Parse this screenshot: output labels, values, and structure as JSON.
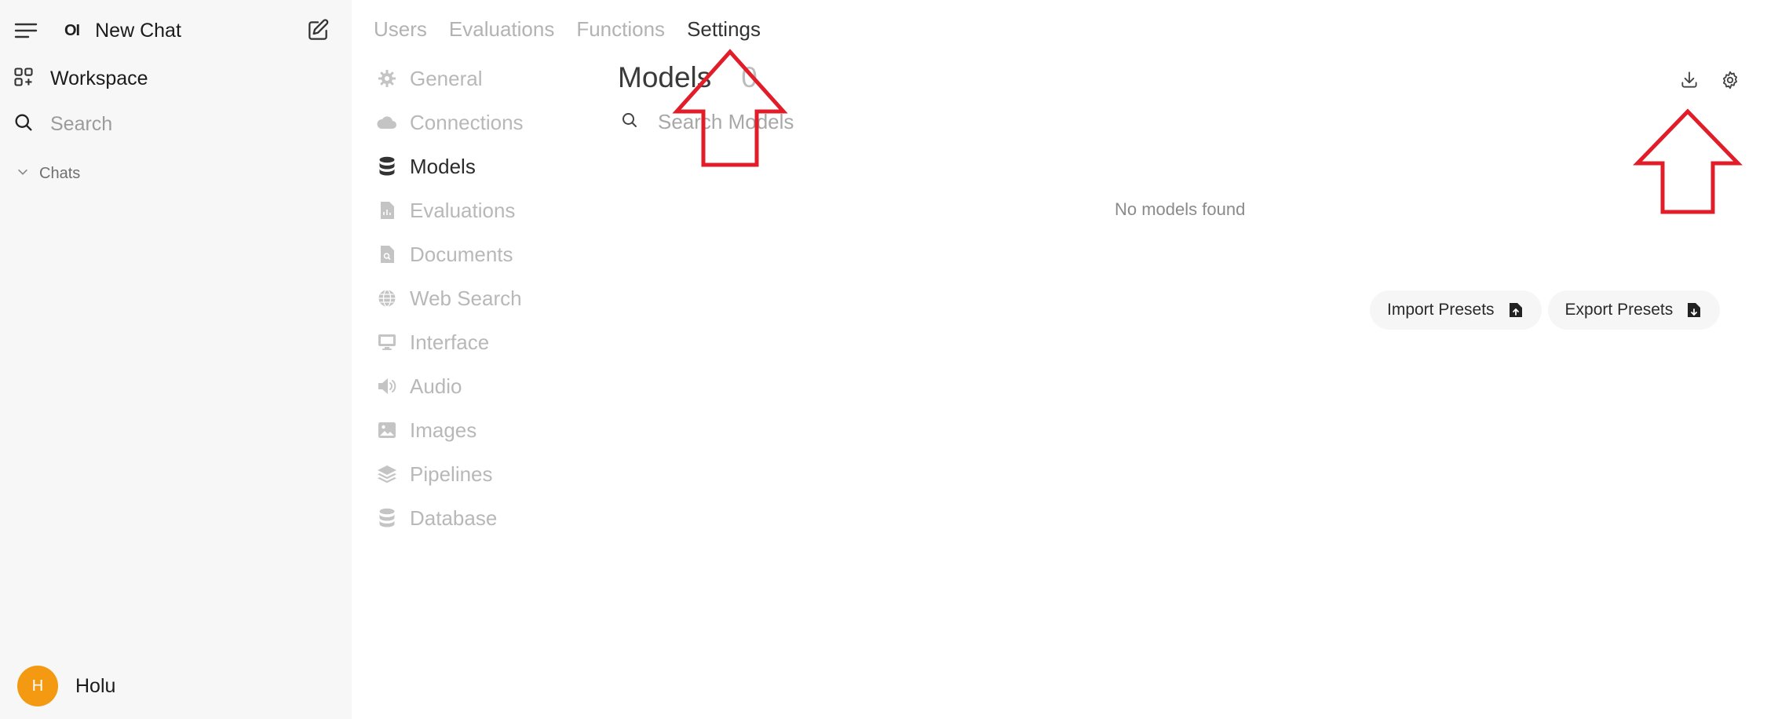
{
  "sidebar": {
    "new_chat": "New Chat",
    "logo": "OI",
    "workspace": "Workspace",
    "search_placeholder": "Search",
    "chats": "Chats",
    "user": {
      "initial": "H",
      "name": "Holu"
    }
  },
  "tabs": [
    {
      "label": "Users",
      "active": false
    },
    {
      "label": "Evaluations",
      "active": false
    },
    {
      "label": "Functions",
      "active": false
    },
    {
      "label": "Settings",
      "active": true
    }
  ],
  "settings_nav": [
    {
      "label": "General",
      "icon": "gear-icon"
    },
    {
      "label": "Connections",
      "icon": "cloud-icon"
    },
    {
      "label": "Models",
      "icon": "database-icon",
      "active": true
    },
    {
      "label": "Evaluations",
      "icon": "document-icon"
    },
    {
      "label": "Documents",
      "icon": "document-search-icon"
    },
    {
      "label": "Web Search",
      "icon": "globe-icon"
    },
    {
      "label": "Interface",
      "icon": "monitor-icon"
    },
    {
      "label": "Audio",
      "icon": "speaker-icon"
    },
    {
      "label": "Images",
      "icon": "image-icon"
    },
    {
      "label": "Pipelines",
      "icon": "layers-icon"
    },
    {
      "label": "Database",
      "icon": "database-icon"
    }
  ],
  "main": {
    "title": "Models",
    "count": "0",
    "search_placeholder": "Search Models",
    "empty_message": "No models found",
    "import_presets": "Import Presets",
    "export_presets": "Export Presets"
  },
  "colors": {
    "annotation_arrow": "#e11d2a",
    "avatar": "#f39a12",
    "sidebar_bg": "#f7f7f7"
  }
}
